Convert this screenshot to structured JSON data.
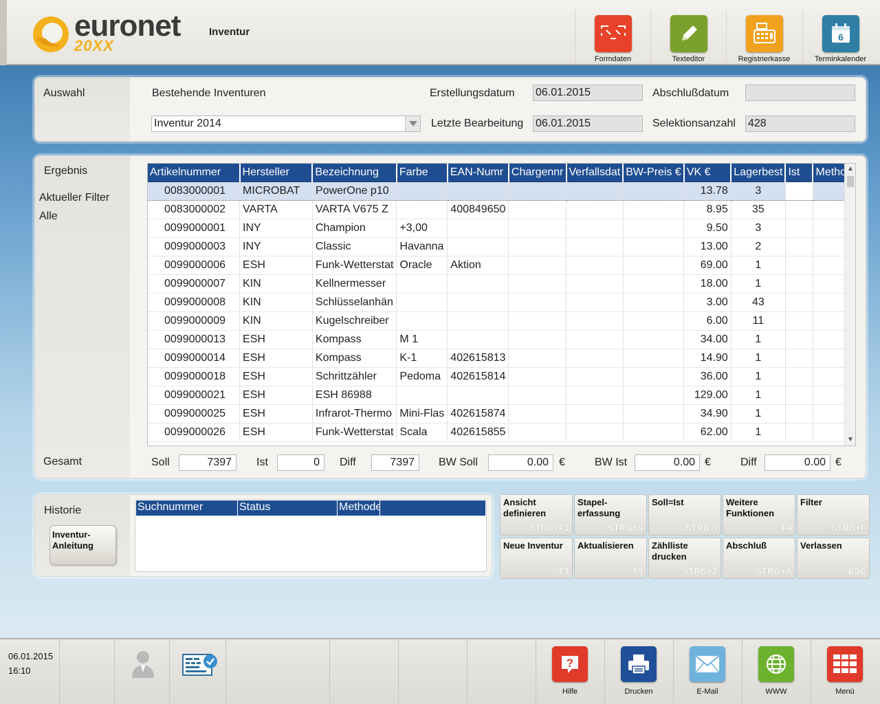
{
  "header": {
    "logo_text": "euronet",
    "logo_sub": "20XX",
    "title": "Inventur",
    "buttons": [
      {
        "label": "Formdaten",
        "icon": "formdaten-icon",
        "color": "#e8432a"
      },
      {
        "label": "Texteditor",
        "icon": "pencil-icon",
        "color": "#7aa12b"
      },
      {
        "label": "Registrierkasse",
        "icon": "cash-register-icon",
        "color": "#f0a21f"
      },
      {
        "label": "Terminkalender",
        "icon": "calendar-icon",
        "color": "#2e7fa3"
      }
    ],
    "calendar_day": "6"
  },
  "auswahl": {
    "section_label": "Auswahl",
    "existing_label": "Bestehende Inventuren",
    "existing_value": "Inventur 2014",
    "created_label": "Erstellungsdatum",
    "created_value": "06.01.2015",
    "closed_label": "Abschlußdatum",
    "closed_value": "",
    "last_edit_label": "Letzte Bearbeitung",
    "last_edit_value": "06.01.2015",
    "selection_label": "Selektionsanzahl",
    "selection_value": "428"
  },
  "ergebnis": {
    "section_label": "Ergebnis",
    "filter_label": "Aktueller Filter",
    "filter_value": "Alle",
    "columns": [
      "Artikelnummer",
      "Hersteller",
      "Bezeichnung",
      "Farbe",
      "EAN-Numr",
      "Chargennr",
      "Verfallsdat",
      "BW-Preis €",
      "VK €",
      "Lagerbest",
      "Ist",
      "Methoc"
    ],
    "rows": [
      [
        "0083000001",
        "MICROBAT",
        "PowerOne p10",
        "",
        "",
        "",
        "",
        "",
        "13.78",
        "3",
        "",
        ""
      ],
      [
        "0083000002",
        "VARTA",
        "VARTA V675 Z",
        "",
        "400849650",
        "",
        "",
        "",
        "8.95",
        "35",
        "",
        ""
      ],
      [
        "0099000001",
        "INY",
        "Champion",
        "+3,00",
        "",
        "",
        "",
        "",
        "9.50",
        "3",
        "",
        ""
      ],
      [
        "0099000003",
        "INY",
        "Classic",
        "Havanna",
        "",
        "",
        "",
        "",
        "13.00",
        "2",
        "",
        ""
      ],
      [
        "0099000006",
        "ESH",
        "Funk-Wetterstat",
        "Oracle",
        "Aktion",
        "",
        "",
        "",
        "69.00",
        "1",
        "",
        ""
      ],
      [
        "0099000007",
        "KIN",
        "Kellnermesser",
        "",
        "",
        "",
        "",
        "",
        "18.00",
        "1",
        "",
        ""
      ],
      [
        "0099000008",
        "KIN",
        "Schlüsselanhän",
        "",
        "",
        "",
        "",
        "",
        "3.00",
        "43",
        "",
        ""
      ],
      [
        "0099000009",
        "KIN",
        "Kugelschreiber",
        "",
        "",
        "",
        "",
        "",
        "6.00",
        "11",
        "",
        ""
      ],
      [
        "0099000013",
        "ESH",
        "Kompass",
        "M 1",
        "",
        "",
        "",
        "",
        "34.00",
        "1",
        "",
        ""
      ],
      [
        "0099000014",
        "ESH",
        "Kompass",
        "K-1",
        "402615813",
        "",
        "",
        "",
        "14.90",
        "1",
        "",
        ""
      ],
      [
        "0099000018",
        "ESH",
        "Schrittzähler",
        "Pedoma",
        "402615814",
        "",
        "",
        "",
        "36.00",
        "1",
        "",
        ""
      ],
      [
        "0099000021",
        "ESH",
        "ESH 86988",
        "",
        "",
        "",
        "",
        "",
        "129.00",
        "1",
        "",
        ""
      ],
      [
        "0099000025",
        "ESH",
        "Infrarot-Thermo",
        "Mini-Flas",
        "402615874",
        "",
        "",
        "",
        "34.90",
        "1",
        "",
        ""
      ],
      [
        "0099000026",
        "ESH",
        "Funk-Wetterstat",
        "Scala",
        "402615855",
        "",
        "",
        "",
        "62.00",
        "1",
        "",
        ""
      ]
    ],
    "selected_row": 0
  },
  "gesamt": {
    "label": "Gesamt",
    "soll_label": "Soll",
    "soll_value": "7397",
    "ist_label": "Ist",
    "ist_value": "0",
    "diff_label": "Diff",
    "diff_value": "7397",
    "bw_soll_label": "BW Soll",
    "bw_soll_value": "0.00",
    "bw_ist_label": "BW Ist",
    "bw_ist_value": "0.00",
    "bw_diff_label": "Diff",
    "bw_diff_value": "0.00",
    "currency": "€"
  },
  "historie": {
    "label": "Historie",
    "guide_button": "Inventur-\nAnleitung",
    "columns": [
      "Suchnummer",
      "Status",
      "Methode"
    ]
  },
  "actions": [
    {
      "label": "Ansicht definieren",
      "key": "STRG+F3"
    },
    {
      "label": "Stapel- erfassung",
      "key": "STRG+S"
    },
    {
      "label": "Soll=Ist",
      "key": "STRG+I"
    },
    {
      "label": "Weitere Funktionen",
      "key": "F4"
    },
    {
      "label": "Filter",
      "key": "STRG+F"
    },
    {
      "label": "Neue Inventur",
      "key": "F3"
    },
    {
      "label": "Aktualisieren",
      "key": "F5"
    },
    {
      "label": "Zählliste drucken",
      "key": "STRG+Z"
    },
    {
      "label": "Abschluß",
      "key": "STRG+A"
    },
    {
      "label": "Verlassen",
      "key": "ESC"
    }
  ],
  "footer": {
    "date": "06.01.2015",
    "time": "16:10",
    "buttons": [
      {
        "label": "Hilfe",
        "icon": "help-icon",
        "color": "#e03a2a"
      },
      {
        "label": "Drucken",
        "icon": "printer-icon",
        "color": "#1f4f98"
      },
      {
        "label": "E-Mail",
        "icon": "mail-icon",
        "color": "#6fb3dd"
      },
      {
        "label": "WWW",
        "icon": "globe-icon",
        "color": "#6db22e"
      },
      {
        "label": "Menü",
        "icon": "menu-grid-icon",
        "color": "#e03a2a"
      }
    ]
  }
}
